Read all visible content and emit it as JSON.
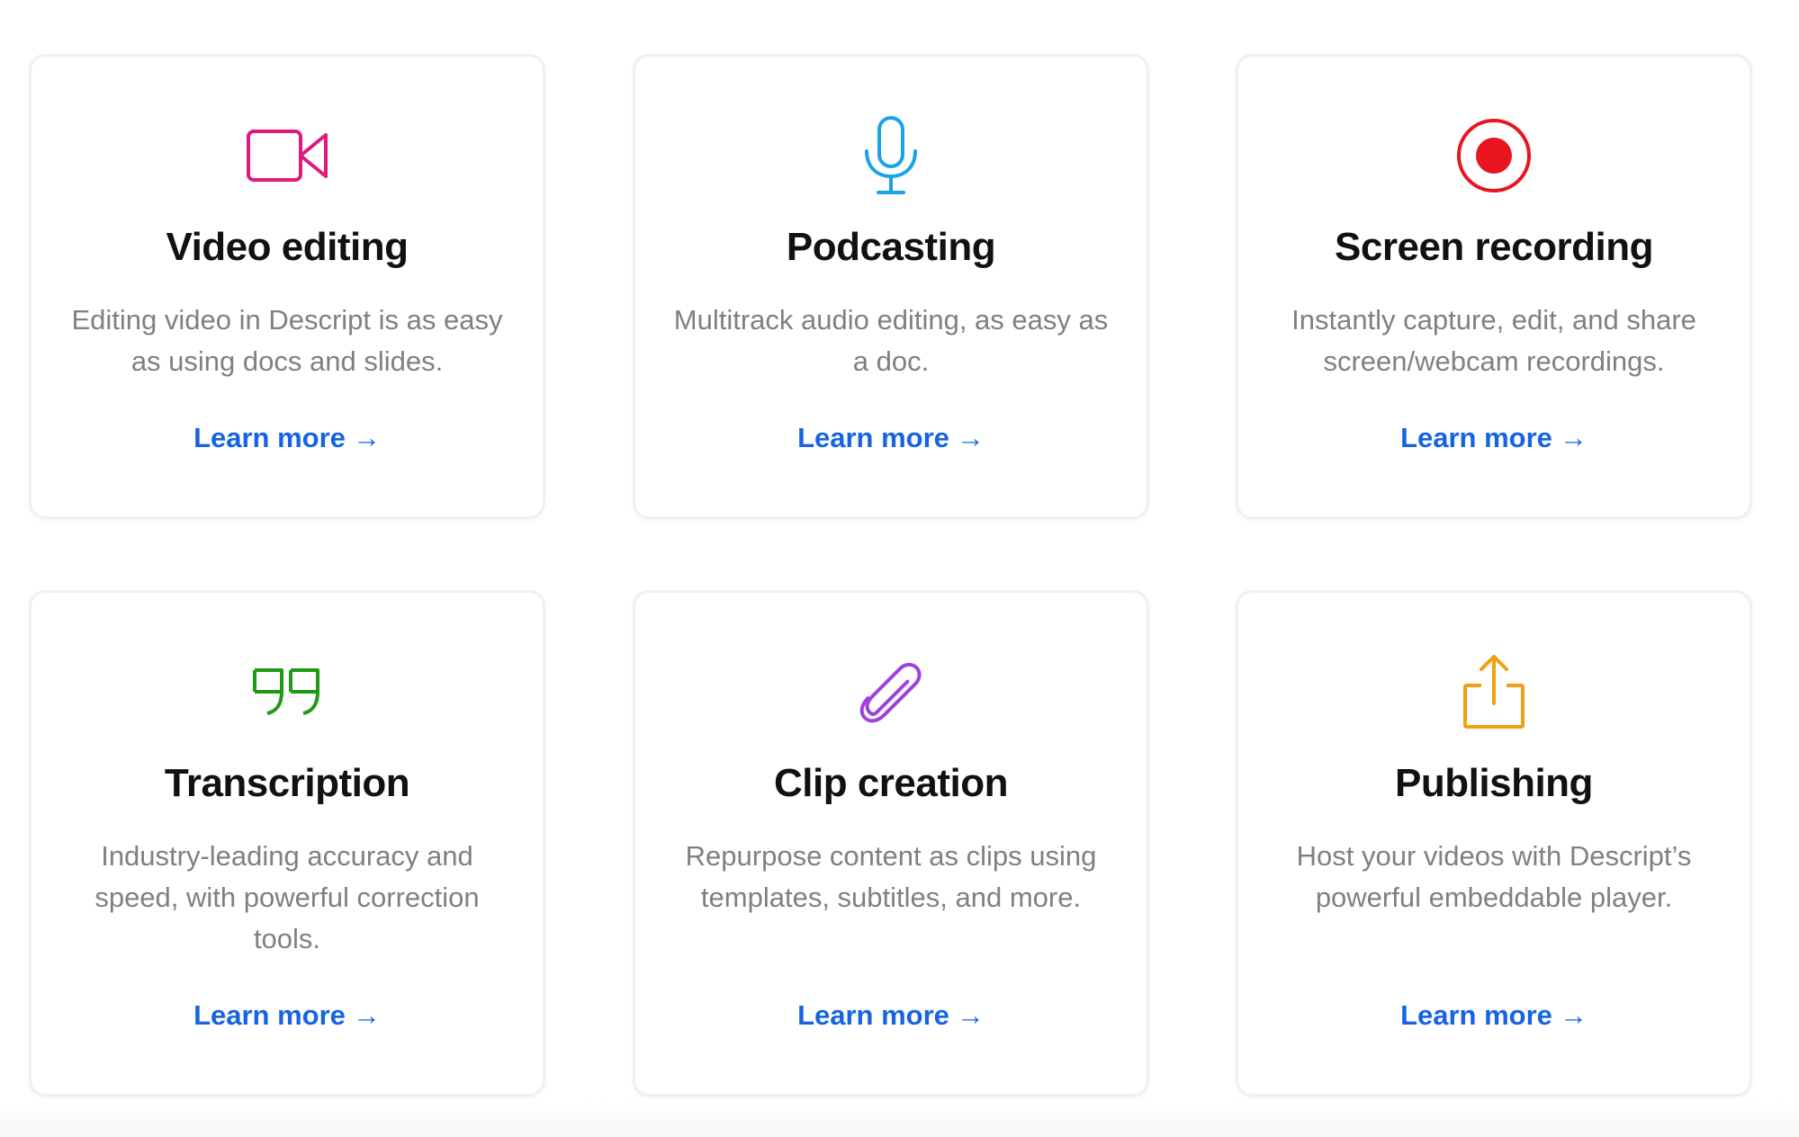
{
  "colors": {
    "video": "#e0197d",
    "podcast": "#1aa3e8",
    "screen": "#e8141e",
    "transcription": "#1e9a14",
    "clip": "#a040e0",
    "publishing": "#f0a010",
    "link": "#1664e3"
  },
  "cards": [
    {
      "icon": "video-camera-icon",
      "title": "Video editing",
      "description": "Editing video in Descript is as easy as using docs and slides.",
      "link_label": "Learn more",
      "link_arrow": "→"
    },
    {
      "icon": "microphone-icon",
      "title": "Podcasting",
      "description": "Multitrack audio editing, as easy as a doc.",
      "link_label": "Learn more",
      "link_arrow": "→"
    },
    {
      "icon": "record-icon",
      "title": "Screen recording",
      "description": "Instantly capture, edit, and share screen/webcam recordings.",
      "link_label": "Learn more",
      "link_arrow": "→"
    },
    {
      "icon": "quote-icon",
      "title": "Transcription",
      "description": "Industry-leading accuracy and speed, with powerful correction tools.",
      "link_label": "Learn more",
      "link_arrow": "→"
    },
    {
      "icon": "paperclip-icon",
      "title": "Clip creation",
      "description": "Repurpose content as clips using templates, subtitles, and more.",
      "link_label": "Learn more",
      "link_arrow": "→"
    },
    {
      "icon": "share-upload-icon",
      "title": "Publishing",
      "description": "Host your videos with Descript’s powerful embeddable player.",
      "link_label": "Learn more",
      "link_arrow": "→"
    }
  ]
}
